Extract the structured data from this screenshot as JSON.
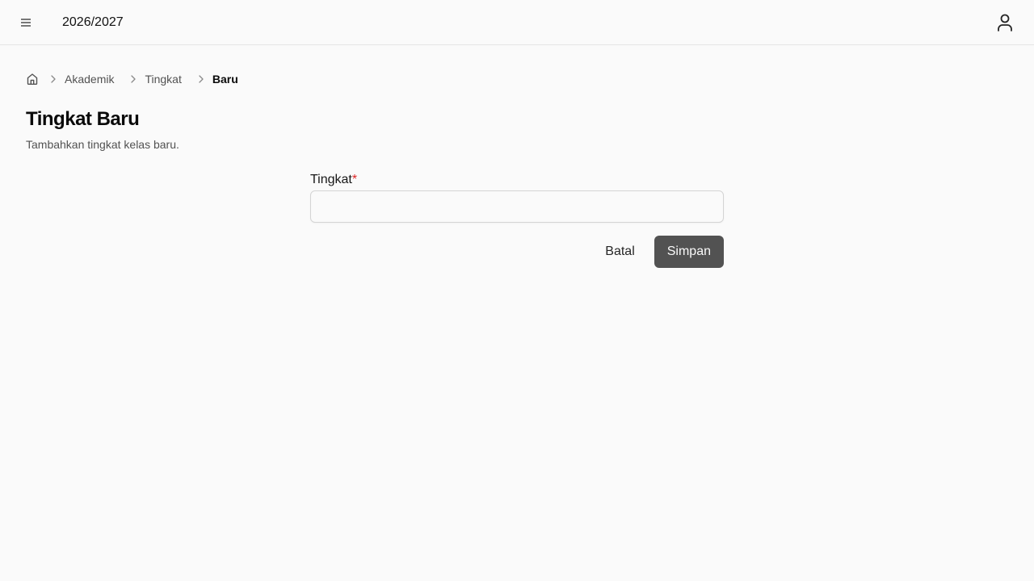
{
  "header": {
    "menu_icon": "menu-icon",
    "academic_year": "2026/2027",
    "user_icon": "user-icon"
  },
  "breadcrumb": {
    "home_icon": "home-icon",
    "items": [
      "Akademik",
      "Tingkat"
    ],
    "current": "Baru"
  },
  "page": {
    "title": "Tingkat Baru",
    "subtitle": "Tambahkan tingkat kelas baru."
  },
  "form": {
    "field_label": "Tingkat",
    "required_marker": "*",
    "field_value": "",
    "cancel_label": "Batal",
    "save_label": "Simpan"
  },
  "colors": {
    "background": "#fafafa",
    "primary_button": "#525252",
    "required": "#dc2626"
  }
}
